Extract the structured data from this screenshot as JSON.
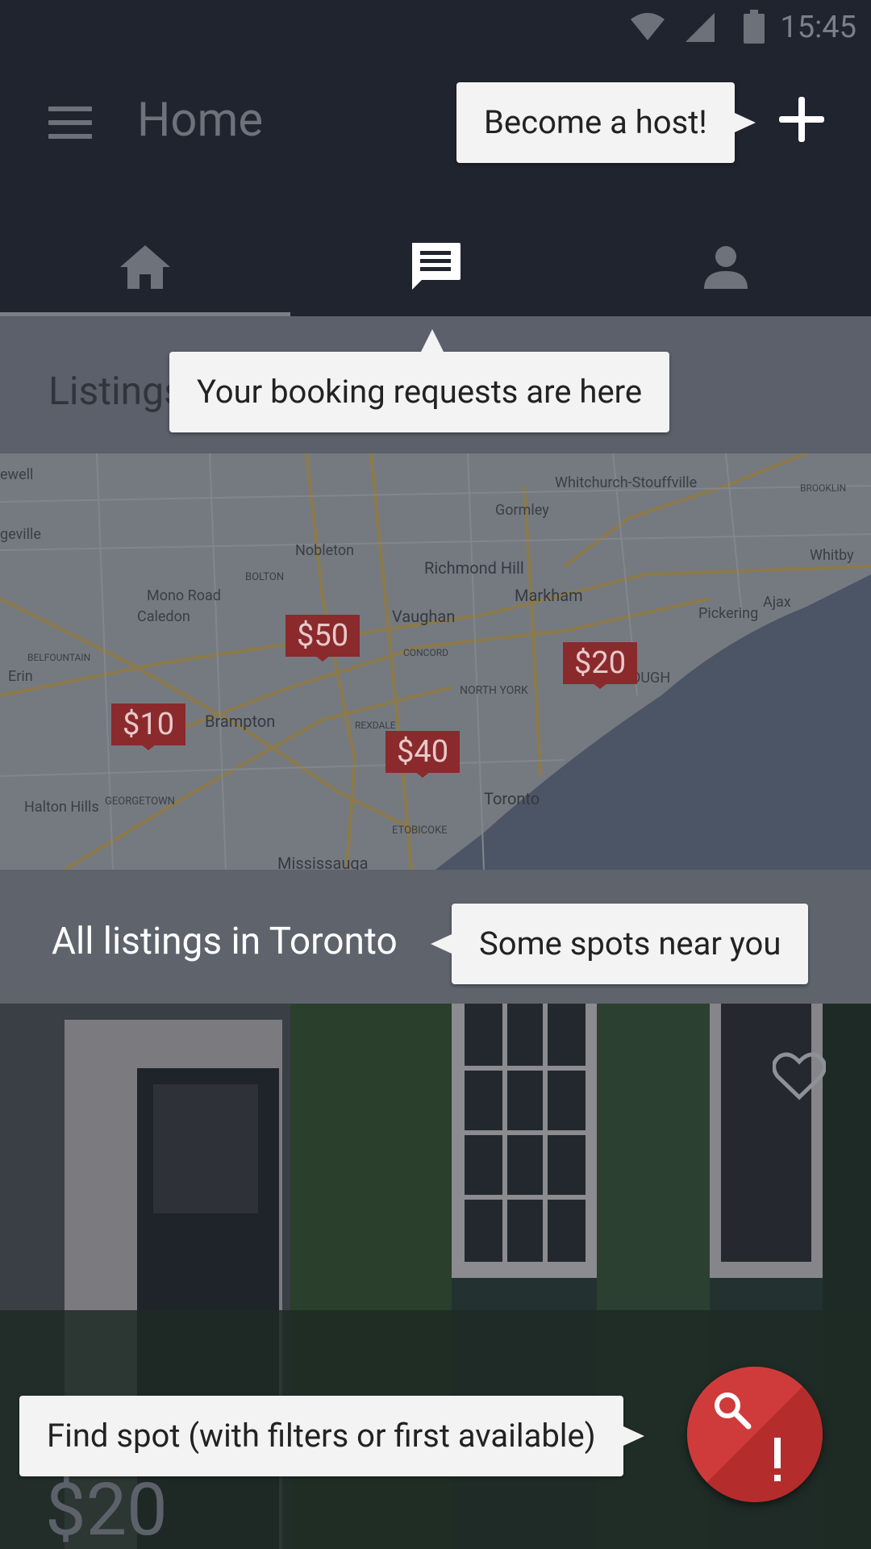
{
  "status_bar": {
    "time": "15:45",
    "icons": [
      "wifi-icon",
      "signal-icon",
      "battery-icon"
    ]
  },
  "app_bar": {
    "title": "Home",
    "menu_icon": "menu-icon",
    "action_icon": "plus-icon"
  },
  "tabs": [
    {
      "name": "home",
      "icon": "home-icon",
      "selected": true
    },
    {
      "name": "messages",
      "icon": "chat-icon",
      "selected": false
    },
    {
      "name": "profile",
      "icon": "person-icon",
      "selected": false
    }
  ],
  "listings": {
    "title": "Listings"
  },
  "map": {
    "places": [
      "Whitchurch-Stouffville",
      "Gormley",
      "Nobleton",
      "Richmond Hill",
      "Markham",
      "Mono Road",
      "Caledon",
      "Vaughan",
      "Pickering",
      "Ajax",
      "Whitby",
      "BOLTON",
      "BELFOUNTAIN",
      "Erin",
      "Brampton",
      "CONCORD",
      "NORTH YORK",
      "REXDALE",
      "Toronto",
      "Halton Hills",
      "GEORGETOWN",
      "ETOBICOKE",
      "Mississauga",
      "BROOKLIN",
      "OUGH",
      "ewell",
      "geville"
    ],
    "pins": [
      "$50",
      "$20",
      "$10",
      "$40"
    ]
  },
  "section": {
    "title": "All listings in Toronto"
  },
  "card": {
    "price": "$20",
    "favorite_icon": "heart-icon"
  },
  "tooltips": {
    "host": "Become a host!",
    "booking": "Your booking requests are here",
    "spots": "Some spots near you",
    "find": "Find spot (with filters or first available)"
  },
  "fab": {
    "icons": [
      "search-icon",
      "exclamation-icon"
    ],
    "accent": "#c23232"
  }
}
